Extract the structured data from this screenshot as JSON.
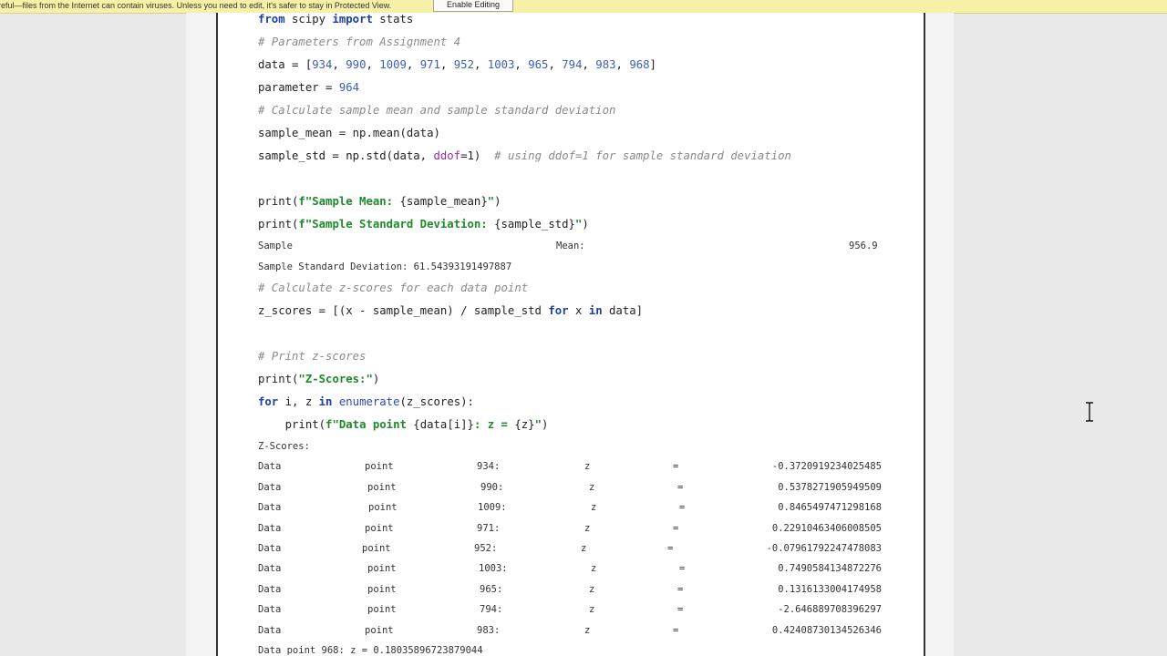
{
  "protected_view": {
    "message": "reful—files from the Internet can contain viruses. Unless you need to edit, it's safer to stay in Protected View.",
    "button_label": "Enable Editing"
  },
  "code": {
    "import_from": "from",
    "import_module": " scipy ",
    "import_kw": "import",
    "import_name": " stats",
    "comment_params": "# Parameters from Assignment 4",
    "data_prefix": "data = [",
    "data_values": [
      "934",
      "990",
      "1009",
      "971",
      "952",
      "1003",
      "965",
      "794",
      "983",
      "968"
    ],
    "data_suffix": "]",
    "param_prefix": "parameter = ",
    "param_value": "964",
    "comment_calc": "# Calculate sample mean and sample standard deviation",
    "mean_line": "sample_mean = np.mean(data)",
    "std_prefix": "sample_std = np.std(data, ",
    "std_param": "ddof",
    "std_mid": "=1)  ",
    "std_comment": "# using ddof=1 for sample standard deviation",
    "print1_a": "print(",
    "print1_str": "f\"Sample Mean: ",
    "print1_b": "{sample_mean}",
    "print1_c": "\"",
    "print1_d": ")",
    "print2_a": "print(",
    "print2_str": "f\"Sample Standard Deviation: ",
    "print2_b": "{sample_std}",
    "print2_c": "\"",
    "print2_d": ")",
    "comment_z": "# Calculate z-scores for each data point",
    "z_a": "z_scores = [(x - sample_mean) / sample_std ",
    "z_for": "for",
    "z_b": " x ",
    "z_in": "in",
    "z_c": " data]",
    "comment_print": "# Print z-scores",
    "print3_a": "print(",
    "print3_str": "\"Z-Scores:\"",
    "print3_b": ")",
    "for_kw": "for",
    "for_a": " i, z ",
    "for_in": "in",
    "for_b": " ",
    "for_fn": "enumerate",
    "for_c": "(z_scores):",
    "print4_a": "    print(",
    "print4_str": "f\"Data point ",
    "print4_b": "{data[i]}",
    "print4_str2": ": z = ",
    "print4_c": "{z}",
    "print4_str3": "\"",
    "print4_d": ")"
  },
  "output": {
    "mean_label": "Sample",
    "mean_label2": "Mean:",
    "mean_value": "956.9",
    "std_line": "Sample Standard Deviation: 61.54393191497887",
    "zscores_header": "Z-Scores:",
    "rows": [
      {
        "data": "Data",
        "point": "point",
        "num": "934:",
        "z": "z",
        "eq": "=",
        "val": "-0.3720919234025485"
      },
      {
        "data": "Data",
        "point": "point",
        "num": "990:",
        "z": "z",
        "eq": "=",
        "val": "0.5378271905949509"
      },
      {
        "data": "Data",
        "point": "point",
        "num": "1009:",
        "z": "z",
        "eq": "=",
        "val": "0.8465497471298168"
      },
      {
        "data": "Data",
        "point": "point",
        "num": "971:",
        "z": "z",
        "eq": "=",
        "val": "0.22910463406008505"
      },
      {
        "data": "Data",
        "point": "point",
        "num": "952:",
        "z": "z",
        "eq": "=",
        "val": "-0.07961792247478083"
      },
      {
        "data": "Data",
        "point": "point",
        "num": "1003:",
        "z": "z",
        "eq": "=",
        "val": "0.7490584134872276"
      },
      {
        "data": "Data",
        "point": "point",
        "num": "965:",
        "z": "z",
        "eq": "=",
        "val": "0.1316133004174958"
      },
      {
        "data": "Data",
        "point": "point",
        "num": "794:",
        "z": "z",
        "eq": "=",
        "val": "-2.646889708396297"
      },
      {
        "data": "Data",
        "point": "point",
        "num": "983:",
        "z": "z",
        "eq": "=",
        "val": "0.42408730134526346"
      }
    ],
    "last_line": "Data point 968: z = 0.18035896723879044"
  }
}
